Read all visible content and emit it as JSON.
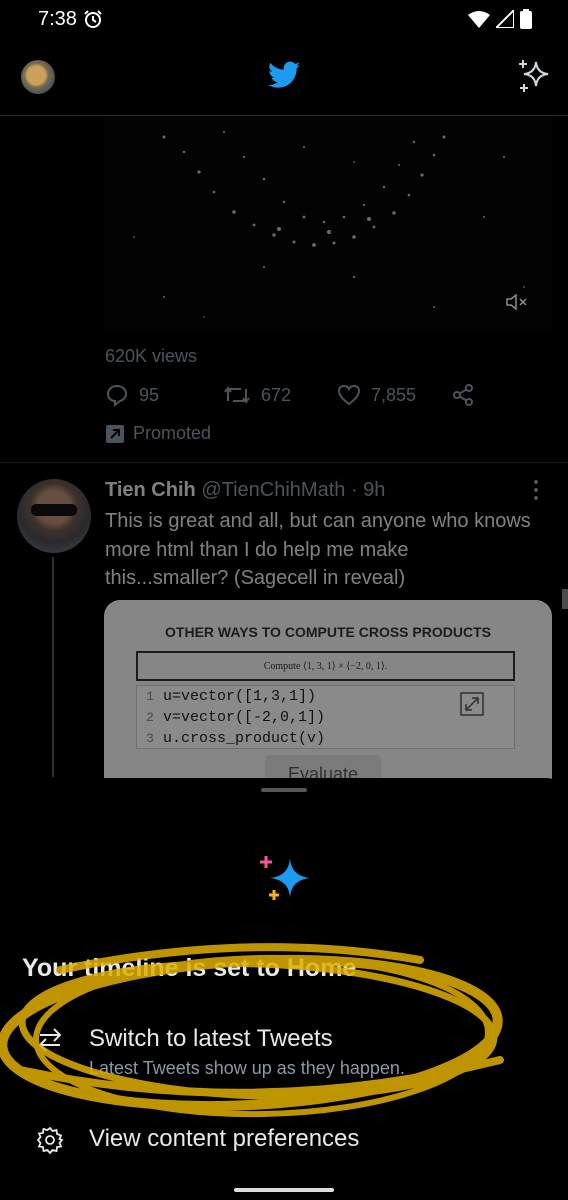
{
  "status_bar": {
    "time": "7:38"
  },
  "icons": {
    "alarm": "alarm-icon",
    "wifi": "wifi-icon",
    "signal": "signal-icon",
    "battery": "battery-icon",
    "bird": "twitter-bird-icon",
    "sparkle": "sparkle-icon",
    "mute": "mute-icon",
    "reply": "reply-icon",
    "retweet": "retweet-icon",
    "like": "like-icon",
    "share": "share-icon",
    "promoted": "promoted-icon",
    "switch": "switch-arrows-icon",
    "gear": "gear-icon",
    "expand": "expand-icon"
  },
  "colors": {
    "brand": "#1d9bf0",
    "sparkle_pink": "#f4569e",
    "sparkle_orange": "#ffad1f",
    "highlight": "#e0b000"
  },
  "promoted_tweet": {
    "views": "620K views",
    "replies": "95",
    "retweets": "672",
    "likes": "7,855",
    "promoted_label": "Promoted"
  },
  "tweet": {
    "name": "Tien Chih",
    "handle": "@TienChihMath",
    "time": "· 9h",
    "text": "This is great and all, but can anyone who knows more html than I do help me make this...smaller? (Sagecell in reveal)",
    "embed": {
      "title": "OTHER WAYS TO COMPUTE CROSS PRODUCTS",
      "compute": "Compute ⟨1, 3, 1⟩ × ⟨−2, 0, 1⟩.",
      "code": [
        {
          "n": "1",
          "line": "u=vector([1,3,1])"
        },
        {
          "n": "2",
          "line": "v=vector([-2,0,1])"
        },
        {
          "n": "3",
          "line": "u.cross_product(v)"
        }
      ],
      "evaluate": "Evaluate"
    }
  },
  "sheet": {
    "title": "Your timeline is set to Home",
    "option1": {
      "label": "Switch to latest Tweets",
      "sub": "Latest Tweets show up as they happen."
    },
    "option2": {
      "label": "View content preferences"
    }
  }
}
